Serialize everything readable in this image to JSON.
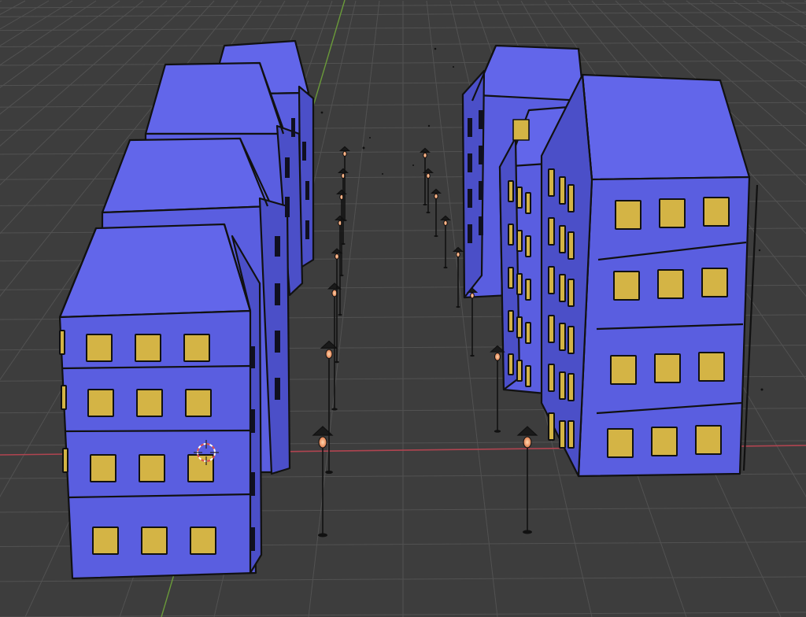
{
  "viewport": {
    "background": "#3d3d3d",
    "grid_color": "#525252",
    "x_axis_color": "#b04450",
    "y_axis_color": "#6a9a3a"
  },
  "scene": {
    "building_wall_color": "#5a5ee0",
    "building_roof_color": "#6266ea",
    "building_side_color": "#4b4fc8",
    "window_color": "#d4b445",
    "outline_color": "#111111",
    "lamp_glow_color": "#f2a07a",
    "left_lamp_count": 8,
    "right_lamp_count": 8
  },
  "cursor": {
    "icon": "3d-cursor-icon",
    "colors": [
      "#e05050",
      "#ffffff"
    ]
  }
}
